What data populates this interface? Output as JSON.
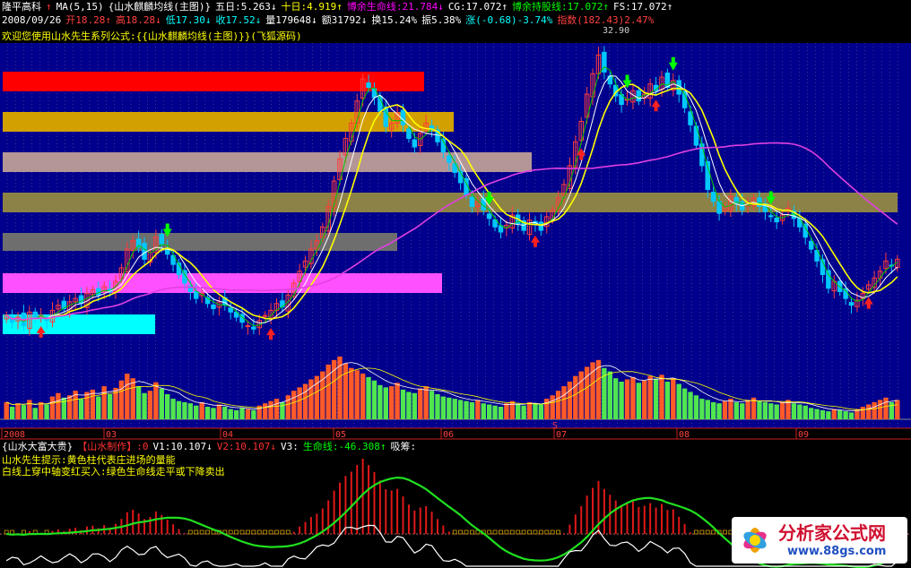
{
  "header": {
    "row1": [
      {
        "text": "隆平高科",
        "color": "#ffffff"
      },
      {
        "text": "↑",
        "color": "#ff3030"
      },
      {
        "text": "MA(5,15)",
        "color": "#ffffff"
      },
      {
        "text": "{山水麒麟均线(主图)}",
        "color": "#ffffff"
      },
      {
        "text": "五日:5.263↓",
        "color": "#ffffff"
      },
      {
        "text": "十日:4.919↑",
        "color": "#ffff00"
      },
      {
        "text": "博余生命线:21.784↓",
        "color": "#ff00ff"
      },
      {
        "text": "CG:17.072↑",
        "color": "#ffffff"
      },
      {
        "text": "博余持股线:17.072↑",
        "color": "#00ff00"
      },
      {
        "text": "FS:17.072↑",
        "color": "#ffffff"
      }
    ],
    "row2": [
      {
        "text": "2008/09/26",
        "color": "#ffffff"
      },
      {
        "text": "开18.28↑",
        "color": "#ff4040"
      },
      {
        "text": "高18.28↓",
        "color": "#ff4040"
      },
      {
        "text": "低17.30↓",
        "color": "#00ffff"
      },
      {
        "text": "收17.52↓",
        "color": "#00ffff"
      },
      {
        "text": "量179648↓",
        "color": "#ffffff"
      },
      {
        "text": "额31792↓",
        "color": "#ffffff"
      },
      {
        "text": "换15.24%",
        "color": "#ffffff"
      },
      {
        "text": "振5.38%",
        "color": "#ffffff"
      },
      {
        "text": "涨(-0.68)-3.74%",
        "color": "#00ffff"
      },
      {
        "text": "指数(182.43)2.47%",
        "color": "#ff4040"
      }
    ],
    "row3": "欢迎您使用山水先生系列公式:{{山水麒麟均线(主图)}}(飞狐源码)",
    "row3_color": "#ffff00"
  },
  "price_axis_label": "32.90",
  "x_axis_labels": [
    "2008",
    "03",
    "04",
    "05",
    "06",
    "07",
    "08",
    "09"
  ],
  "volume_marker": "S",
  "sub_header": [
    {
      "text": "{山水大富大贵}",
      "color": "#ffffff"
    },
    {
      "text": "【山水制作】:0",
      "color": "#ff3030"
    },
    {
      "text": "V1:10.107↓",
      "color": "#ffffff"
    },
    {
      "text": "V2:10.107↓",
      "color": "#ff3030"
    },
    {
      "text": "V3:",
      "color": "#ffffff"
    },
    {
      "text": "生命线:-46.308↑",
      "color": "#00ff00"
    },
    {
      "text": "吸筹:",
      "color": "#ffffff"
    }
  ],
  "sub_tips": [
    "山水先生提示:黄色柱代表庄进场的量能",
    "白线上穿中轴变红买入:绿色生命线走平或下降卖出"
  ],
  "sub_tips_color": "#ffff00",
  "watermark": {
    "line1": "分析家公式网",
    "line2": "www.88gs.com"
  },
  "colors": {
    "up": "#ff3c3c",
    "down": "#00c8ff",
    "vol_up": "#ff5a28",
    "vol_down": "#50e650",
    "ma5": "#ffffff",
    "ma10": "#ffff00",
    "life_line": "#e040e0",
    "hold_line": "#00c800",
    "background_main": "#00008c"
  },
  "chart_data": {
    "type": "candlestick",
    "price_bands": [
      {
        "color": "#ff0000"
      },
      {
        "color": "#d2a000"
      },
      {
        "color": "#b49696"
      },
      {
        "color": "#8c8246"
      },
      {
        "color": "#6e6e6e"
      },
      {
        "color": "#ff50ff"
      },
      {
        "color": "#00ffff"
      }
    ],
    "close": [
      17.6,
      17.2,
      17.5,
      17.0,
      17.8,
      17.4,
      17.6,
      17.3,
      17.9,
      18.2,
      18.0,
      18.4,
      18.6,
      18.3,
      18.9,
      19.1,
      18.8,
      19.3,
      19.0,
      19.6,
      20.4,
      21.5,
      22.0,
      21.6,
      20.9,
      21.3,
      22.2,
      21.8,
      21.2,
      20.6,
      20.0,
      19.5,
      19.0,
      18.6,
      18.9,
      18.3,
      18.0,
      18.4,
      18.2,
      17.8,
      17.5,
      17.2,
      17.0,
      16.8,
      17.3,
      17.6,
      17.9,
      18.3,
      18.1,
      18.8,
      19.5,
      20.2,
      20.8,
      21.5,
      22.0,
      22.8,
      24.0,
      25.5,
      26.8,
      28.0,
      28.9,
      30.2,
      31.5,
      31.0,
      30.4,
      29.6,
      28.7,
      28.9,
      29.5,
      28.8,
      28.0,
      27.5,
      28.3,
      28.9,
      28.5,
      27.8,
      27.2,
      26.6,
      26.0,
      25.4,
      24.7,
      24.0,
      24.3,
      23.8,
      23.3,
      22.8,
      22.5,
      22.9,
      23.5,
      23.0,
      22.6,
      23.2,
      23.0,
      22.6,
      23.4,
      23.8,
      24.5,
      25.3,
      26.4,
      27.8,
      29.0,
      30.6,
      31.8,
      32.9,
      31.9,
      31.2,
      30.5,
      30.0,
      30.3,
      30.8,
      30.2,
      30.6,
      31.2,
      30.8,
      31.6,
      31.0,
      31.4,
      30.6,
      29.8,
      28.8,
      27.6,
      26.4,
      25.0,
      24.3,
      23.6,
      24.0,
      24.6,
      24.2,
      23.8,
      24.2,
      24.5,
      24.0,
      23.7,
      23.4,
      23.1,
      23.5,
      23.9,
      23.3,
      22.8,
      22.2,
      21.5,
      20.8,
      20.0,
      19.2,
      19.6,
      19.0,
      18.6,
      18.2,
      18.5,
      18.9,
      19.4,
      19.8,
      20.2,
      20.8,
      20.5,
      20.9
    ],
    "volume": [
      30,
      22,
      28,
      25,
      34,
      20,
      30,
      26,
      40,
      46,
      38,
      42,
      50,
      36,
      48,
      52,
      40,
      58,
      44,
      55,
      68,
      80,
      72,
      58,
      46,
      50,
      65,
      54,
      44,
      36,
      32,
      30,
      28,
      24,
      30,
      22,
      20,
      26,
      22,
      18,
      16,
      20,
      18,
      16,
      24,
      28,
      32,
      36,
      30,
      42,
      50,
      56,
      62,
      70,
      76,
      84,
      96,
      104,
      110,
      98,
      90,
      86,
      80,
      74,
      68,
      60,
      56,
      58,
      64,
      52,
      48,
      46,
      54,
      58,
      50,
      44,
      40,
      38,
      36,
      34,
      32,
      30,
      34,
      28,
      26,
      24,
      22,
      28,
      32,
      26,
      24,
      30,
      28,
      26,
      36,
      42,
      50,
      58,
      66,
      76,
      84,
      92,
      100,
      104,
      90,
      84,
      72,
      66,
      70,
      74,
      64,
      68,
      76,
      70,
      78,
      66,
      72,
      62,
      54,
      48,
      42,
      36,
      34,
      30,
      28,
      32,
      36,
      30,
      28,
      34,
      38,
      32,
      30,
      28,
      26,
      30,
      34,
      28,
      26,
      24,
      20,
      18,
      16,
      14,
      18,
      16,
      14,
      12,
      18,
      22,
      26,
      30,
      34,
      38,
      30,
      34
    ],
    "sub_series_note": "oscillator with red bars, green life line, white line",
    "marks": [
      {
        "type": "sell-arrow",
        "i": 28
      },
      {
        "type": "buy-arrow",
        "i": 46
      },
      {
        "type": "sell-arrow",
        "i": 84
      },
      {
        "type": "buy-arrow",
        "i": 92
      },
      {
        "type": "buy-arrow",
        "i": 100
      },
      {
        "type": "sell-arrow",
        "i": 108
      },
      {
        "type": "buy-arrow",
        "i": 113
      },
      {
        "type": "sell-arrow",
        "i": 116
      },
      {
        "type": "sell-arrow",
        "i": 133
      },
      {
        "type": "buy-arrow",
        "i": 6
      },
      {
        "type": "buy-arrow",
        "i": 150
      }
    ]
  }
}
